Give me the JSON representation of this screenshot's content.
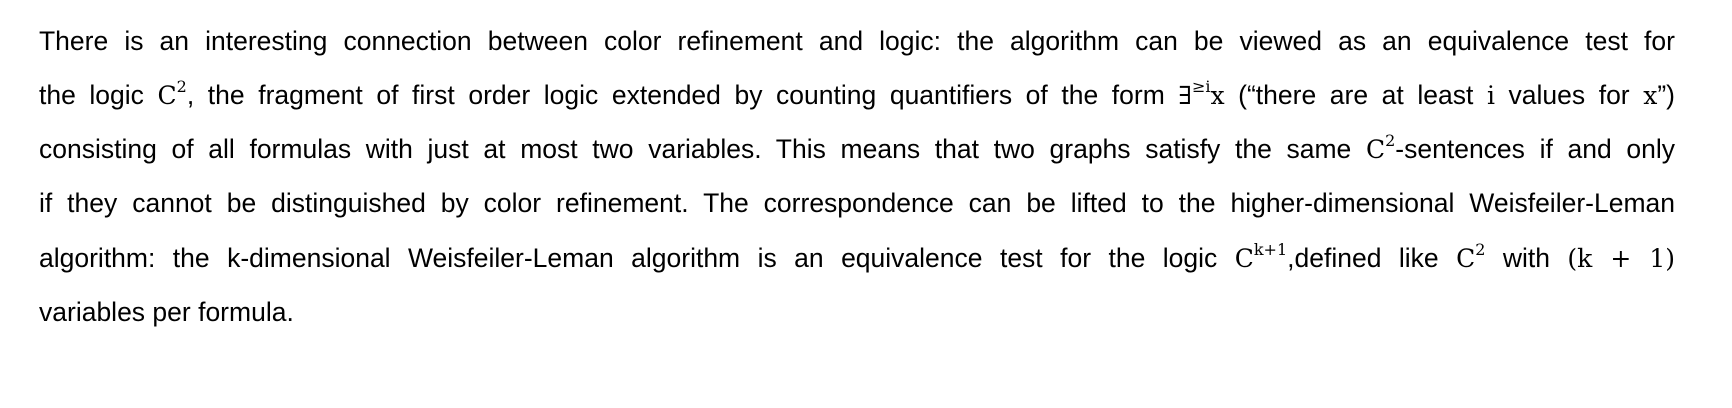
{
  "paragraph": {
    "line1": "There is an interesting connection between color refinement and logic: the algorithm can be viewed as an equivalence test for",
    "line2": {
      "t1": "the logic ",
      "m1": "C",
      "m1_sup": "2",
      "t2": ", the fragment of first order logic extended by counting quantifiers of the form ",
      "m2": "∃",
      "m2_sup": "≥i",
      "m2_var": "x",
      "t3": " (“there are at least ",
      "m3": "i",
      "t4": " values for ",
      "m4": "x",
      "t5": "”)"
    },
    "line3": {
      "t1": "consisting of all formulas with just at most two variables. This means that two graphs satisfy the same ",
      "m1": "C",
      "m1_sup": "2",
      "t2": "-sentences if and only"
    },
    "line4": "if they cannot be distinguished by color refinement. The correspondence can be lifted to the higher-dimensional Weisfeiler-Leman",
    "line5": {
      "t1": "algorithm: the k-dimensional Weisfeiler-Leman algorithm is an equivalence test for the logic ",
      "m1": "C",
      "m1_sup": "k+1",
      "t2": ",defined like ",
      "m2": "C",
      "m2_sup": "2",
      "t3": " with ",
      "m3": "(k + 1)"
    },
    "line6": "variables per formula."
  }
}
